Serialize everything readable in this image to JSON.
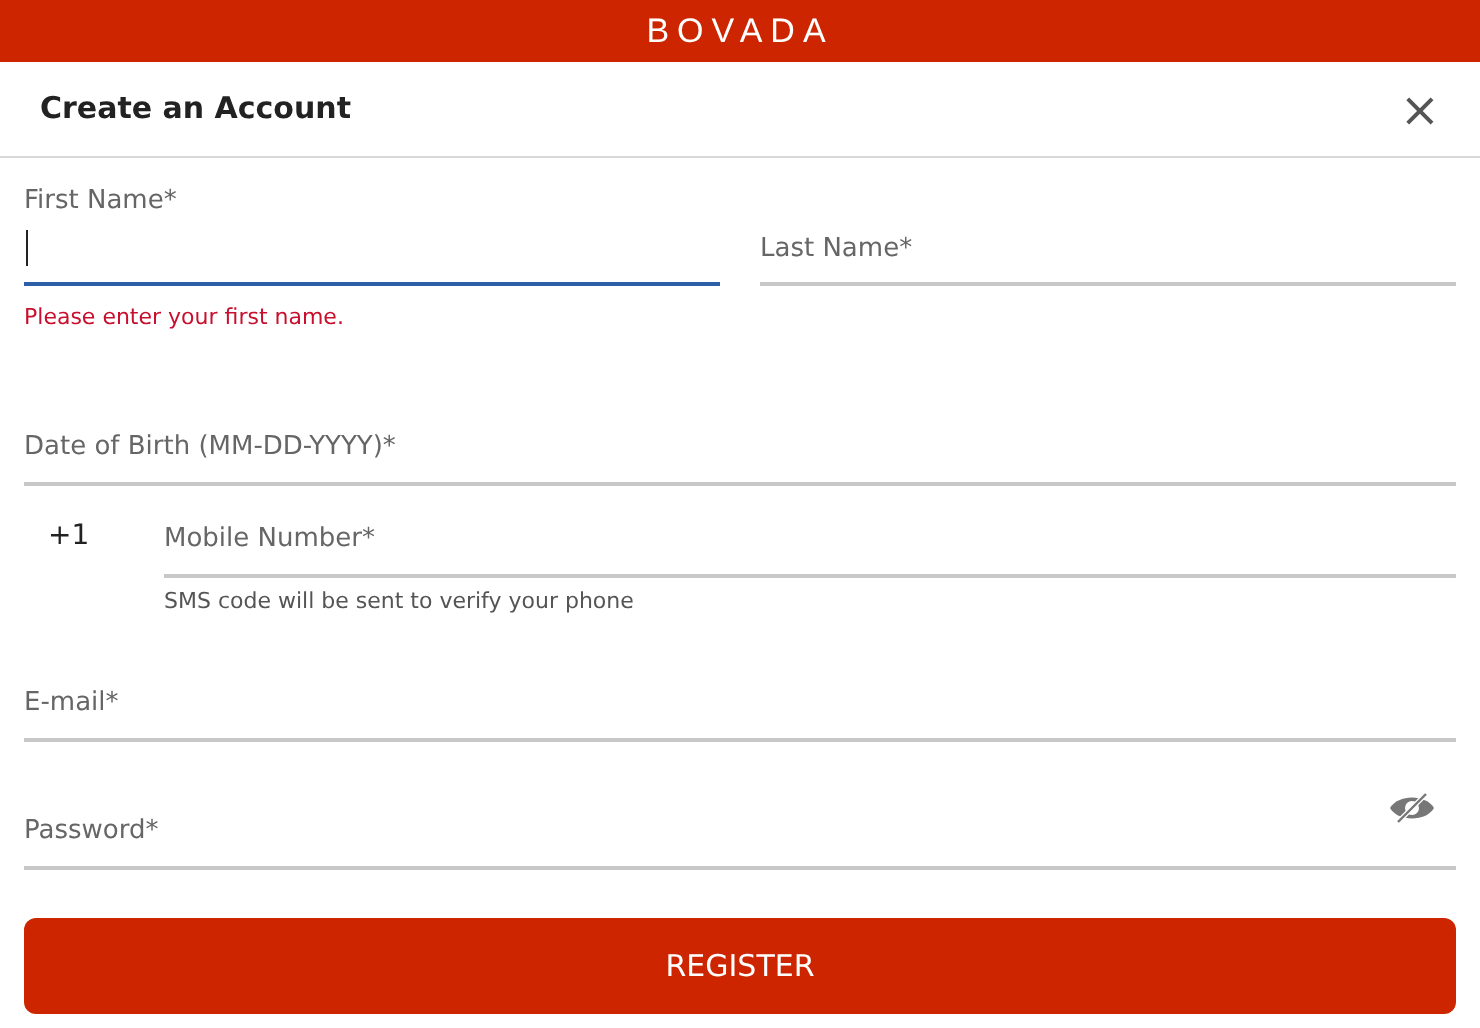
{
  "brand": "BOVADA",
  "dialog": {
    "title": "Create an Account",
    "close": "×"
  },
  "name_fields": [
    {
      "label": "First Name*",
      "focused": true,
      "error": "Please enter your first name."
    },
    {
      "label": "Last Name*",
      "focused": false
    }
  ],
  "fields": [
    {
      "kind": "text",
      "label": "Date of Birth (MM-DD-YYYY)*"
    },
    {
      "kind": "phone",
      "prefix": "+1",
      "label": "Mobile Number*",
      "hint": "SMS code will be sent to verify your phone"
    },
    {
      "kind": "text",
      "label": "E-mail*"
    },
    {
      "kind": "password",
      "label": "Password*"
    }
  ],
  "submit": "REGISTER"
}
